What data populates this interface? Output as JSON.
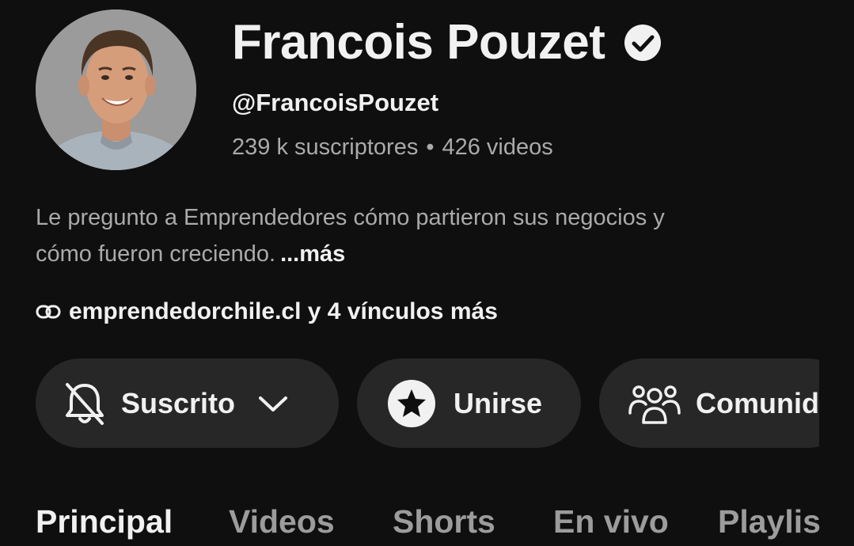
{
  "channel": {
    "name": "Francois Pouzet",
    "verified_icon": "verified-check-icon",
    "handle": "@FrancoisPouzet",
    "subscribers": "239 k suscriptores",
    "separator": "•",
    "videos": "426 videos"
  },
  "description": {
    "line1": "Le pregunto a Emprendedores cómo partieron sus negocios y",
    "line2": "cómo fueron creciendo.",
    "more_label": "...más"
  },
  "links": {
    "icon": "link-icon",
    "text": "emprendedorchile.cl y 4 vínculos más"
  },
  "actions": {
    "subscribed": {
      "label": "Suscrito",
      "icon": "bell-off-icon",
      "dropdown_icon": "chevron-down-icon"
    },
    "join": {
      "label": "Unirse",
      "icon": "star-icon"
    },
    "community": {
      "label": "Comunid",
      "icon": "community-icon"
    }
  },
  "tabs": [
    {
      "label": "Principal",
      "active": true
    },
    {
      "label": "Videos",
      "active": false
    },
    {
      "label": "Shorts",
      "active": false
    },
    {
      "label": "En vivo",
      "active": false
    },
    {
      "label": "Playlis",
      "active": false
    }
  ],
  "colors": {
    "background": "#0f0f0f",
    "pill": "#272727",
    "text_primary": "#f1f1f1",
    "text_secondary": "#aaaaaa"
  }
}
